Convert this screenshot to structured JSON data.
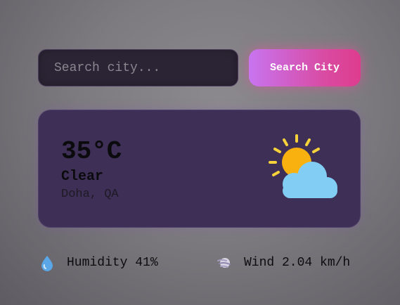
{
  "search": {
    "placeholder": "Search city...",
    "value": "",
    "button_label": "Search City"
  },
  "weather": {
    "temperature": "35°C",
    "condition": "Clear",
    "location": "Doha, QA",
    "icon": "sun-behind-cloud-icon"
  },
  "stats": {
    "humidity_text": "Humidity 41%",
    "humidity_icon": "droplet-icon",
    "wind_text": "Wind 2.04 km/h",
    "wind_icon": "wind-icon"
  },
  "colors": {
    "accent_start": "#c874f0",
    "accent_end": "#de3c8e",
    "card_background": "#3e2f57",
    "sun": "#f9b10f",
    "cloud": "#82cdf4"
  }
}
